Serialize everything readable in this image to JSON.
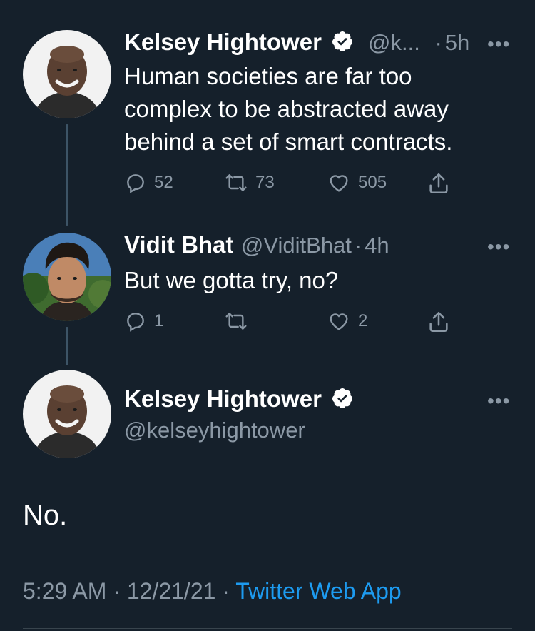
{
  "tweets": [
    {
      "name": "Kelsey Hightower",
      "handle": "@k...",
      "time": "5h",
      "body_lines": [
        "Human societies are far too",
        "complex to be abstracted away",
        "behind a set of smart contracts."
      ],
      "replies": "52",
      "retweets": "73",
      "likes": "505"
    },
    {
      "name": "Vidit Bhat",
      "handle": "@ViditBhat",
      "time": "4h",
      "body_lines": [
        "But we gotta try, no?"
      ],
      "replies": "1",
      "retweets": "",
      "likes": "2"
    }
  ],
  "main_tweet": {
    "name": "Kelsey Hightower",
    "handle": "@kelseyhightower",
    "text": "No.",
    "time": "5:29 AM",
    "date": "12/21/21",
    "separator": "·",
    "source": "Twitter Web App"
  },
  "more_icon": "•••",
  "colors": {
    "background": "#15202b",
    "secondary_text": "#8b98a5",
    "link": "#1d9bf0",
    "thread_line": "#3d5466"
  },
  "icons": [
    "reply-icon",
    "retweet-icon",
    "like-icon",
    "share-icon",
    "verified-badge-icon",
    "more-icon"
  ]
}
